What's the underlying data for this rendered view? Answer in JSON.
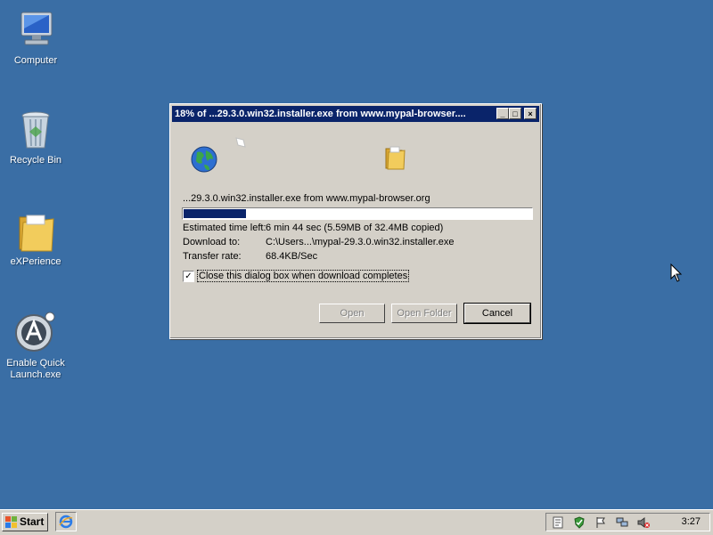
{
  "desktop": {
    "icons": [
      {
        "label": "Computer",
        "icon": "computer-icon"
      },
      {
        "label": "Recycle Bin",
        "icon": "recycle-bin-icon"
      },
      {
        "label": "eXPerience",
        "icon": "folder-icon"
      },
      {
        "label": "Enable Quick Launch.exe",
        "icon": "app-icon"
      }
    ]
  },
  "dialog": {
    "title": "18% of ...29.3.0.win32.installer.exe from www.mypal-browser....",
    "source": "...29.3.0.win32.installer.exe from www.mypal-browser.org",
    "progress_fraction": 0.18,
    "fields": [
      {
        "label": "Estimated time left:",
        "value": "6 min 44 sec (5.59MB of 32.4MB copied)"
      },
      {
        "label": "Download to:",
        "value": "C:\\Users...\\mypal-29.3.0.win32.installer.exe"
      },
      {
        "label": "Transfer rate:",
        "value": "68.4KB/Sec"
      }
    ],
    "close_checkbox": {
      "label": "Close this dialog box when download completes",
      "checked": true
    },
    "buttons": {
      "open": "Open",
      "open_folder": "Open Folder",
      "cancel": "Cancel"
    },
    "controls": {
      "minimize": "_",
      "maximize": "□",
      "close": "×"
    }
  },
  "taskbar": {
    "start_label": "Start",
    "clock": "3:27",
    "tray_icons": [
      "notes-icon",
      "security-shield-icon",
      "flag-icon",
      "network-icon",
      "volume-muted-icon"
    ]
  },
  "colors": {
    "desktop": "#3a6ea5",
    "titlebar": "#0a246a",
    "progress": "#0a246a",
    "face": "#d4d0c8"
  }
}
